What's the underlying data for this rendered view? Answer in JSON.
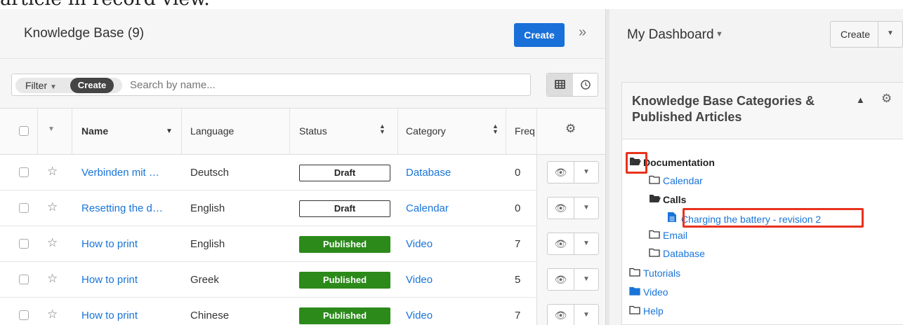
{
  "caption": "article in record view.",
  "list": {
    "title": "Knowledge Base (9)",
    "create_label": "Create",
    "collapse_icon": "»",
    "filter": {
      "filter_label": "Filter",
      "create_label": "Create",
      "search_placeholder": "Search by name..."
    },
    "columns": {
      "name": "Name",
      "language": "Language",
      "status": "Status",
      "category": "Category",
      "frequency": "Freq"
    },
    "rows": [
      {
        "name": "Verbinden mit …",
        "language": "Deutsch",
        "status": "Draft",
        "category": "Database",
        "freq": "0"
      },
      {
        "name": "Resetting the d…",
        "language": "English",
        "status": "Draft",
        "category": "Calendar",
        "freq": "0"
      },
      {
        "name": "How to print",
        "language": "English",
        "status": "Published",
        "category": "Video",
        "freq": "7"
      },
      {
        "name": "How to print",
        "language": "Greek",
        "status": "Published",
        "category": "Video",
        "freq": "5"
      },
      {
        "name": "How to print",
        "language": "Chinese",
        "status": "Published",
        "category": "Video",
        "freq": "7"
      }
    ]
  },
  "dashboard": {
    "title": "My Dashboard",
    "create_label": "Create",
    "dashlet": {
      "title": "Knowledge Base Categories & Published Articles",
      "tree": {
        "documentation": "Documentation",
        "calendar": "Calendar",
        "calls": "Calls",
        "article": "Charging the battery - revision 2",
        "email": "Email",
        "database": "Database",
        "tutorials": "Tutorials",
        "video": "Video",
        "help": "Help"
      }
    }
  },
  "colors": {
    "accent": "#1870d8",
    "published": "#2b8a1a",
    "highlight": "#e8321e"
  }
}
